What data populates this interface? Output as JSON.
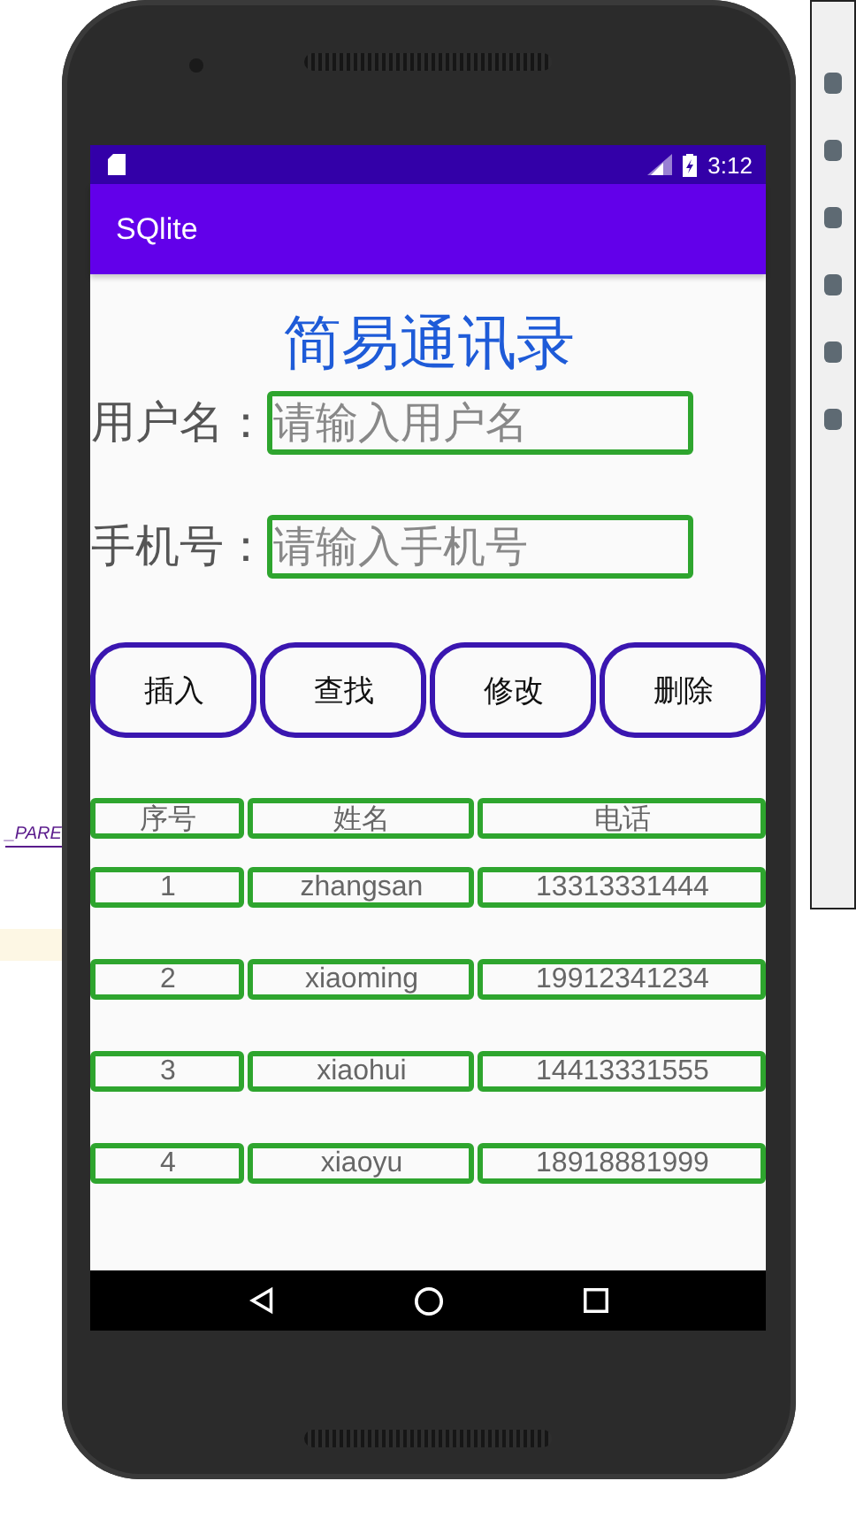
{
  "ide": {
    "left_text": "_PARE"
  },
  "status_bar": {
    "time": "3:12"
  },
  "app_bar": {
    "title": "SQlite"
  },
  "heading": "简易通讯录",
  "fields": [
    {
      "label": "用户名：",
      "placeholder": "请输入用户名"
    },
    {
      "label": "手机号：",
      "placeholder": "请输入手机号"
    }
  ],
  "buttons": [
    "插入",
    "查找",
    "修改",
    "删除"
  ],
  "table": {
    "columns": [
      "序号",
      "姓名",
      "电话"
    ],
    "rows": [
      [
        "1",
        "zhangsan",
        "13313331444"
      ],
      [
        "2",
        "xiaoming",
        "19912341234"
      ],
      [
        "3",
        "xiaohui",
        "14413331555"
      ],
      [
        "4",
        "xiaoyu",
        "18918881999"
      ]
    ]
  }
}
